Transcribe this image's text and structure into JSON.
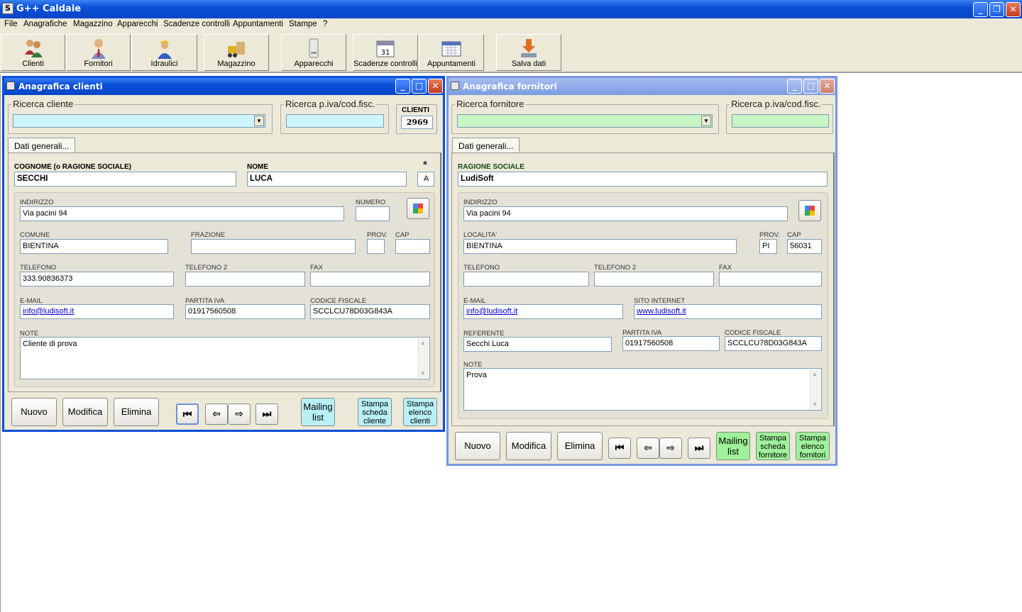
{
  "app": {
    "title": "G++ Caldaie",
    "icon": "S"
  },
  "menu": [
    "File",
    "Anagrafiche",
    "Magazzino",
    "Apparecchi",
    "Scadenze controlli",
    "Appuntamenti",
    "Stampe",
    "?"
  ],
  "toolbar": [
    {
      "label": "Clienti",
      "icon": "people-icon"
    },
    {
      "label": "Fornitori",
      "icon": "person-tie-icon"
    },
    {
      "label": "Idraulici",
      "icon": "worker-icon"
    },
    {
      "label": "Magazzino",
      "icon": "forklift-icon"
    },
    {
      "label": "Apparecchi",
      "icon": "boiler-icon"
    },
    {
      "label": "Scadenze controlli",
      "icon": "calendar-day-icon"
    },
    {
      "label": "Appuntamenti",
      "icon": "calendar-icon"
    },
    {
      "label": "Salva dati",
      "icon": "save-icon"
    }
  ],
  "clienti": {
    "title": "Anagrafica clienti",
    "search_label": "Ricerca cliente",
    "search_value": "",
    "piva_search_label": "Ricerca p.iva/cod.fisc.",
    "piva_search_value": "",
    "count_label": "CLIENTI",
    "count_value": "2969",
    "tab": "Dati generali...",
    "cognome_label": "COGNOME (o RAGIONE SOCIALE)",
    "cognome": "SECCHI",
    "nome_label": "NOME",
    "nome": "LUCA",
    "star": "*",
    "tipo": "A",
    "indirizzo_label": "INDIRIZZO",
    "indirizzo": "Via pacini 94",
    "numero_label": "NUMERO",
    "numero": "",
    "comune_label": "COMUNE",
    "comune": "BIENTINA",
    "frazione_label": "FRAZIONE",
    "frazione": "",
    "prov_label": "PROV.",
    "prov": "",
    "cap_label": "CAP",
    "cap": "",
    "telefono_label": "TELEFONO",
    "telefono": "333.90836373",
    "telefono2_label": "TELEFONO 2",
    "telefono2": "",
    "fax_label": "FAX",
    "fax": "",
    "email_label": "E-MAIL",
    "email": "info@ludisoft.it",
    "piva_label": "PARTITA IVA",
    "piva": "01917560508",
    "cf_label": "CODICE FISCALE",
    "cf": "SCCLCU78D03G843A",
    "note_label": "NOTE",
    "note": "Cliente di prova",
    "btn_nuovo": "Nuovo",
    "btn_modifica": "Modifica",
    "btn_elimina": "Elimina",
    "btn_mailing_1": "Mailing",
    "btn_mailing_2": "list",
    "btn_scheda_1": "Stampa",
    "btn_scheda_2": "scheda",
    "btn_scheda_3": "cliente",
    "btn_elenco_1": "Stampa",
    "btn_elenco_2": "elenco",
    "btn_elenco_3": "clienti",
    "accent": "#ccf5fb"
  },
  "fornitori": {
    "title": "Anagrafica fornitori",
    "search_label": "Ricerca fornitore",
    "search_value": "",
    "piva_search_label": "Ricerca p.iva/cod.fisc.",
    "piva_search_value": "",
    "tab": "Dati generali...",
    "ragione_label": "RAGIONE SOCIALE",
    "ragione": "LudiSoft",
    "indirizzo_label": "INDIRIZZO",
    "indirizzo": "Via pacini 94",
    "localita_label": "LOCALITA'",
    "localita": "BIENTINA",
    "prov_label": "PROV.",
    "prov": "PI",
    "cap_label": "CAP",
    "cap": "56031",
    "telefono_label": "TELEFONO",
    "telefono": "",
    "telefono2_label": "TELEFONO 2",
    "telefono2": "",
    "fax_label": "FAX",
    "fax": "",
    "email_label": "E-MAIL",
    "email": "info@ludisoft.it",
    "sito_label": "SITO INTERNET",
    "sito": "www.ludisoft.it",
    "referente_label": "REFERENTE",
    "referente": "Secchi Luca",
    "piva_label": "PARTITA IVA",
    "piva": "01917560508",
    "cf_label": "CODICE FISCALE",
    "cf": "SCCLCU78D03G843A",
    "note_label": "NOTE",
    "note": "Prova",
    "btn_nuovo": "Nuovo",
    "btn_modifica": "Modifica",
    "btn_elimina": "Elimina",
    "btn_mailing_1": "Mailing",
    "btn_mailing_2": "list",
    "btn_scheda_1": "Stampa",
    "btn_scheda_2": "scheda",
    "btn_scheda_3": "fornitore",
    "btn_elenco_1": "Stampa",
    "btn_elenco_2": "elenco",
    "btn_elenco_3": "fornitori",
    "accent": "#c8f5c4"
  }
}
